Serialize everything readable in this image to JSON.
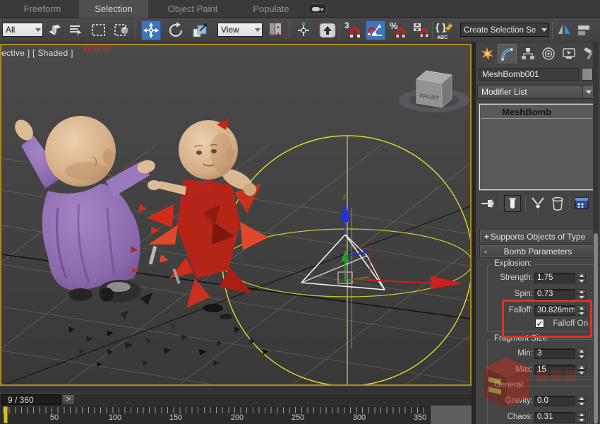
{
  "ribbon": {
    "tabs": [
      {
        "label": "Freeform"
      },
      {
        "label": "Selection"
      },
      {
        "label": "Object Paint"
      },
      {
        "label": "Populate"
      }
    ],
    "active_tab": "Selection"
  },
  "toolbar": {
    "selection_filter_value": "All",
    "reference_value": "View",
    "selection_set_value": "Create Selection Se",
    "snap3_label": "3",
    "percent_label": "%",
    "named_sets_braces": "{ }",
    "named_sets_abc": "ABC"
  },
  "viewport": {
    "label": "ective ] [ Shaded ]",
    "viewcube_face": "FRONT",
    "z_axis_label": "z"
  },
  "command_panel": {
    "object_name": "MeshBomb001",
    "modifier_list_value": "Modifier List",
    "stack_item": "MeshBomb",
    "rollouts": {
      "supports": {
        "toggle": "+",
        "title": "Supports Objects of Type"
      },
      "bomb": {
        "toggle": "-",
        "title": "Bomb Parameters"
      }
    },
    "explosion": {
      "title": "Explosion:",
      "strength": {
        "label": "Strength:",
        "value": "1.75"
      },
      "spin": {
        "label": "Spin:",
        "value": "0.73"
      },
      "falloff": {
        "label": "Falloff:",
        "value": "30.826mm"
      },
      "falloff_on": {
        "label": "Falloff On",
        "checked": true,
        "check_glyph": "✓"
      }
    },
    "fragment_size": {
      "title": "Fragment Size:",
      "min": {
        "label": "Min:",
        "value": "3"
      },
      "max": {
        "label": "Max:",
        "value": "15"
      }
    },
    "general": {
      "title": "General:",
      "gravity": {
        "label": "Gravity:",
        "value": "0.0"
      },
      "chaos": {
        "label": "Chaos:",
        "value": "0.31"
      }
    }
  },
  "timeline": {
    "frame_display": "9 / 360",
    "next_label": ">",
    "ticks": [
      "50",
      "100",
      "150",
      "200",
      "250",
      "300",
      "350"
    ]
  },
  "watermark": {
    "text": "www"
  },
  "colors": {
    "accent_blue": "#3f76b8",
    "active_viewport_border": "#ab8a1e",
    "highlight_red": "#e03222",
    "axis_x_red": "#cf1f1f",
    "axis_y_green": "#1faf1f",
    "axis_z_blue": "#2a3fd0",
    "falloff_sphere_yellow": "#d9d92e"
  }
}
